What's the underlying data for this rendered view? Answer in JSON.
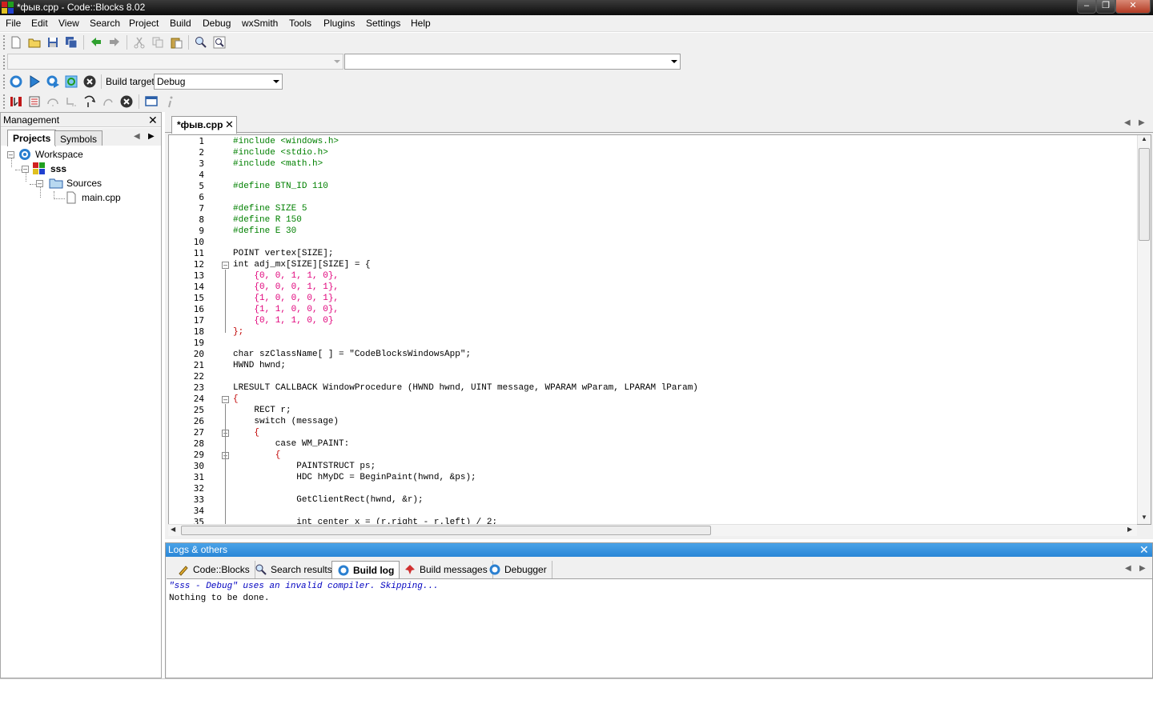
{
  "window": {
    "title": "*фыв.cpp - Code::Blocks 8.02"
  },
  "menu": [
    "File",
    "Edit",
    "View",
    "Search",
    "Project",
    "Build",
    "Debug",
    "wxSmith",
    "Tools",
    "Plugins",
    "Settings",
    "Help"
  ],
  "build_target": {
    "label": "Build target:",
    "value": "Debug"
  },
  "management": {
    "title": "Management",
    "tabs": [
      "Projects",
      "Symbols"
    ],
    "tree": {
      "workspace": "Workspace",
      "project": "sss",
      "folder": "Sources",
      "file": "main.cpp"
    }
  },
  "editor": {
    "tab_label": "*фыв.cpp",
    "lines": [
      {
        "n": "1",
        "t": "#include <windows.h>",
        "c": "#008000"
      },
      {
        "n": "2",
        "t": "#include <stdio.h>",
        "c": "#008000"
      },
      {
        "n": "3",
        "t": "#include <math.h>",
        "c": "#008000"
      },
      {
        "n": "4",
        "t": "",
        "c": "#000000"
      },
      {
        "n": "5",
        "t": "#define BTN_ID 110",
        "c": "#008000"
      },
      {
        "n": "6",
        "t": "",
        "c": "#000000"
      },
      {
        "n": "7",
        "t": "#define SIZE 5",
        "c": "#008000"
      },
      {
        "n": "8",
        "t": "#define R 150",
        "c": "#008000"
      },
      {
        "n": "9",
        "t": "#define E 30",
        "c": "#008000"
      },
      {
        "n": "10",
        "t": "",
        "c": "#000000"
      },
      {
        "n": "11",
        "t": "POINT vertex[SIZE];",
        "c": "#000000"
      },
      {
        "n": "12",
        "t": "int adj_mx[SIZE][SIZE] = {",
        "c": "#000000"
      },
      {
        "n": "13",
        "t": "    {0, 0, 1, 1, 0},",
        "c": "#e0007a"
      },
      {
        "n": "14",
        "t": "    {0, 0, 0, 1, 1},",
        "c": "#e0007a"
      },
      {
        "n": "15",
        "t": "    {1, 0, 0, 0, 1},",
        "c": "#e0007a"
      },
      {
        "n": "16",
        "t": "    {1, 1, 0, 0, 0},",
        "c": "#e0007a"
      },
      {
        "n": "17",
        "t": "    {0, 1, 1, 0, 0}",
        "c": "#e0007a"
      },
      {
        "n": "18",
        "t": "};",
        "c": "#c00000"
      },
      {
        "n": "19",
        "t": "",
        "c": "#000000"
      },
      {
        "n": "20",
        "t": "char szClassName[ ] = \"CodeBlocksWindowsApp\";",
        "c": "#000000"
      },
      {
        "n": "21",
        "t": "HWND hwnd;",
        "c": "#000000"
      },
      {
        "n": "22",
        "t": "",
        "c": "#000000"
      },
      {
        "n": "23",
        "t": "LRESULT CALLBACK WindowProcedure (HWND hwnd, UINT message, WPARAM wParam, LPARAM lParam)",
        "c": "#000000"
      },
      {
        "n": "24",
        "t": "{",
        "c": "#c00000"
      },
      {
        "n": "25",
        "t": "    RECT r;",
        "c": "#000000"
      },
      {
        "n": "26",
        "t": "    switch (message)",
        "c": "#000000"
      },
      {
        "n": "27",
        "t": "    {",
        "c": "#c00000"
      },
      {
        "n": "28",
        "t": "        case WM_PAINT:",
        "c": "#000000"
      },
      {
        "n": "29",
        "t": "        {",
        "c": "#c00000"
      },
      {
        "n": "30",
        "t": "            PAINTSTRUCT ps;",
        "c": "#000000"
      },
      {
        "n": "31",
        "t": "            HDC hMyDC = BeginPaint(hwnd, &ps);",
        "c": "#000000"
      },
      {
        "n": "32",
        "t": "",
        "c": "#000000"
      },
      {
        "n": "33",
        "t": "            GetClientRect(hwnd, &r);",
        "c": "#000000"
      },
      {
        "n": "34",
        "t": "",
        "c": "#000000"
      },
      {
        "n": "35",
        "t": "            int center_x = (r.right - r.left) / 2;",
        "c": "#000000"
      }
    ]
  },
  "logs": {
    "title": "Logs & others",
    "tabs": [
      "Code::Blocks",
      "Search results",
      "Build log",
      "Build messages",
      "Debugger"
    ],
    "lines": [
      "\"sss - Debug\" uses an invalid compiler. Skipping...",
      "Nothing to be done."
    ]
  },
  "colors": {
    "keyword": "#00007f",
    "preproc": "#008000",
    "number": "#e0007a",
    "string": "#0000c0",
    "operator": "#c00000",
    "accent": "#2a86d6"
  }
}
